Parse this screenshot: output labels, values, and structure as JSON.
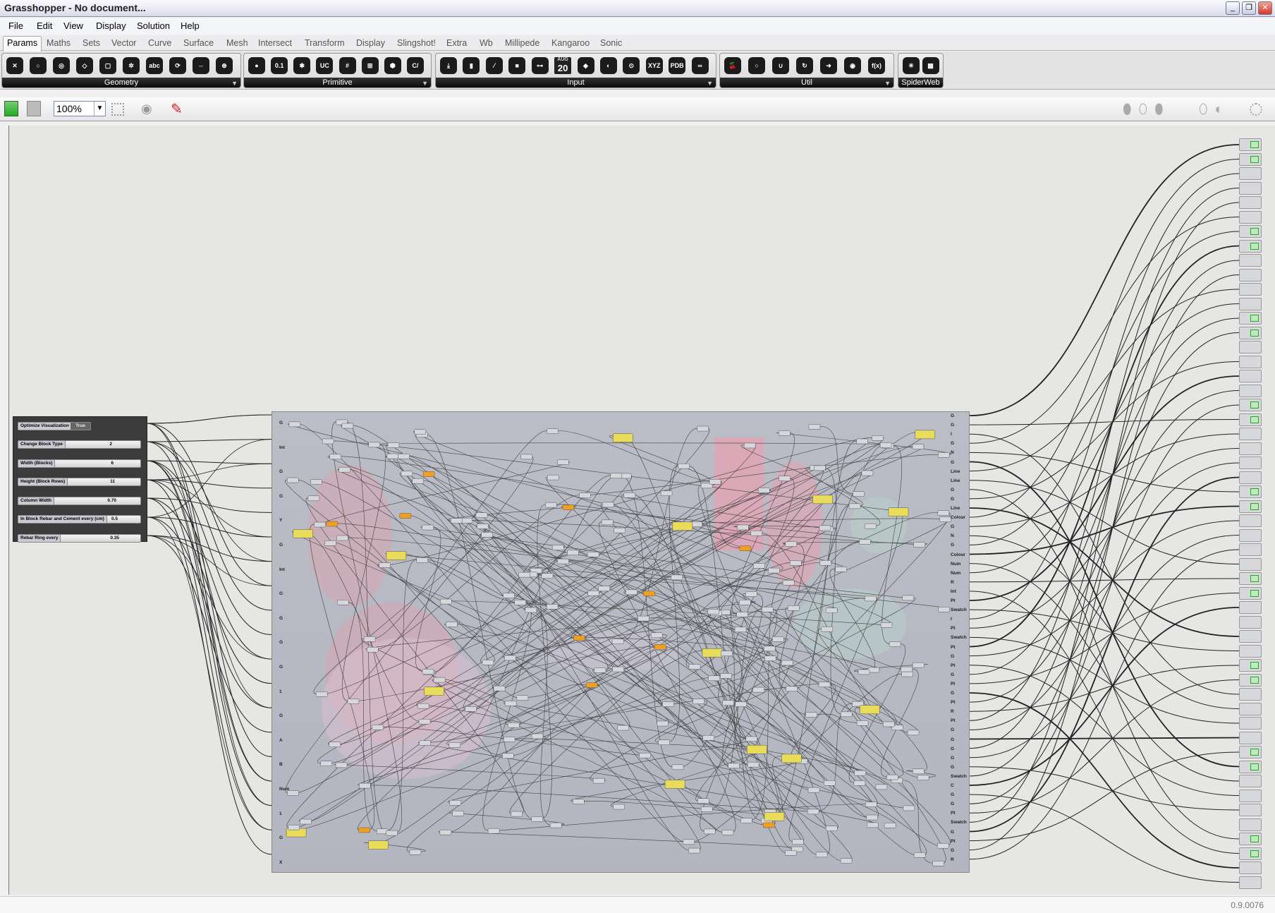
{
  "window": {
    "title": "Grasshopper - No document...",
    "controls": [
      "minimize",
      "restore",
      "close"
    ]
  },
  "menu": [
    "File",
    "Edit",
    "View",
    "Display",
    "Solution",
    "Help"
  ],
  "tabs": [
    "Params",
    "Maths",
    "Sets",
    "Vector",
    "Curve",
    "Surface",
    "Mesh",
    "Intersect",
    "Transform",
    "Display",
    "Slingshot!",
    "Extra",
    "Wb",
    "Millipede",
    "Kangaroo",
    "Sonic"
  ],
  "active_tab": "Params",
  "ribbon": {
    "groups": [
      {
        "label": "Geometry",
        "icons": [
          "✕",
          "○",
          "◎",
          "◇",
          "▢",
          "✲",
          "abc",
          "⟳",
          "⇔",
          "⊛"
        ]
      },
      {
        "label": "Primitive",
        "icons": [
          "●",
          "0.1",
          "✱",
          "UC",
          "#",
          "⊞",
          "⬢",
          "C/"
        ]
      },
      {
        "label": "Input",
        "icons": [
          "⤓",
          "▮",
          "⁄",
          "■",
          "⊶",
          "20",
          "◆",
          "◐",
          "⊙",
          "XYZ",
          "PDB",
          "∞"
        ]
      },
      {
        "label": "Util",
        "icons": [
          "🍒",
          "○",
          "∪",
          "↻",
          "➜",
          "◉",
          "f(x)"
        ]
      },
      {
        "label": "SpiderWeb",
        "icons": [
          "✳",
          "▦"
        ]
      }
    ],
    "date_icon": {
      "month": "AUG",
      "day": "20"
    }
  },
  "canvas_toolbar": {
    "zoom": "100%"
  },
  "panel": {
    "toggle": {
      "label": "Optimize Visualization",
      "value": "True"
    },
    "sliders": [
      {
        "label": "Change Block Type",
        "value": "2"
      },
      {
        "label": "Width (Blocks)",
        "value": "6"
      },
      {
        "label": "Height (Block Rows)",
        "value": "11"
      },
      {
        "label": "Column Width",
        "value": "0.70"
      },
      {
        "label": "In Block Rebar and Cement every (cm)",
        "value": "0.5"
      },
      {
        "label": "Rebar Ring every",
        "value": "0.35"
      }
    ]
  },
  "cluster": {
    "inputs": [
      "G",
      "Int",
      "G",
      "G",
      "Y",
      "G",
      "Int",
      "G",
      "G",
      "G",
      "G",
      "1",
      "G",
      "A",
      "B",
      "Num",
      "1",
      "G",
      "X"
    ],
    "outputs": [
      "G",
      "G",
      "I",
      "G",
      "N",
      "G",
      "Line",
      "Line",
      "G",
      "G",
      "Line",
      "Colour",
      "G",
      "N",
      "G",
      "Colour",
      "Num",
      "Num",
      "R",
      "Int",
      "Pt",
      "Swatch",
      "I",
      "Pt",
      "Swatch",
      "Pt",
      "G",
      "Pt",
      "G",
      "Pl",
      "G",
      "Pt",
      "R",
      "Pt",
      "G",
      "G",
      "G",
      "G",
      "G",
      "Swatch",
      "C",
      "G",
      "G",
      "Pt",
      "Swatch",
      "G",
      "Pt",
      "G",
      "R"
    ]
  },
  "colors": {
    "canvas": "#e6e7e4",
    "cluster": "#b7b9c3",
    "panel": "#3b3b3b",
    "node_yellow": "#e8dc5a",
    "node_orange": "#f0a020",
    "group_pink": "#e8a0b0"
  },
  "status": {
    "version": "0.9.0076"
  }
}
